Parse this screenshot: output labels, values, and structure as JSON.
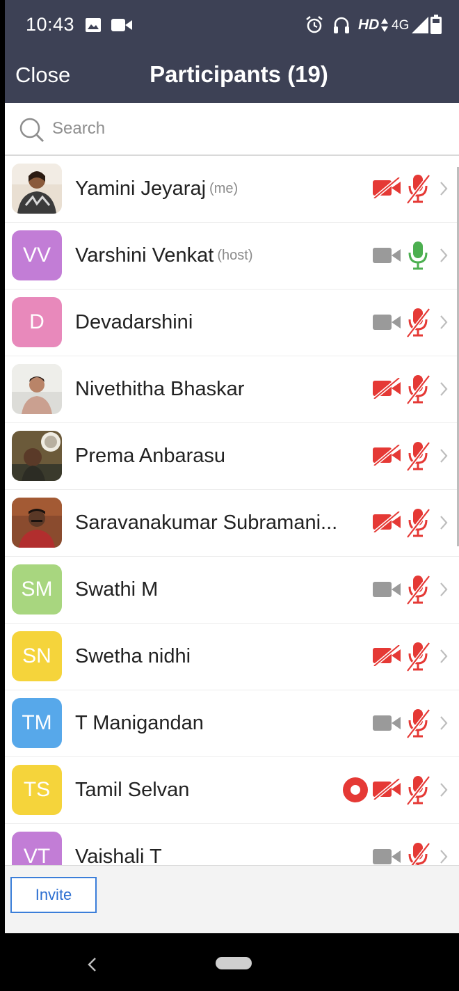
{
  "status_bar": {
    "time": "10:43",
    "network_label": "HD",
    "signal_label": "4G"
  },
  "header": {
    "close_label": "Close",
    "title": "Participants (19)"
  },
  "search": {
    "placeholder": "Search",
    "value": ""
  },
  "participants": [
    {
      "name": "Yamini Jeyaraj",
      "tag": "(me)",
      "avatar": "photo",
      "video": "off",
      "mic": "muted",
      "recording": false
    },
    {
      "name": "Varshini Venkat",
      "tag": "(host)",
      "avatar": "initials",
      "initials": "VV",
      "color": "#c27dd6",
      "video": "on",
      "mic": "active",
      "recording": false
    },
    {
      "name": "Devadarshini",
      "tag": "",
      "avatar": "initials",
      "initials": "D",
      "color": "#e889bb",
      "video": "on",
      "mic": "muted",
      "recording": false
    },
    {
      "name": "Nivethitha Bhaskar",
      "tag": "",
      "avatar": "photo",
      "video": "off",
      "mic": "muted",
      "recording": false
    },
    {
      "name": "Prema Anbarasu",
      "tag": "",
      "avatar": "photo",
      "video": "off",
      "mic": "muted",
      "recording": false
    },
    {
      "name": "Saravanakumar Subramani...",
      "tag": "",
      "avatar": "photo",
      "video": "off",
      "mic": "muted",
      "recording": false
    },
    {
      "name": "Swathi M",
      "tag": "",
      "avatar": "initials",
      "initials": "SM",
      "color": "#a8d67f",
      "video": "on",
      "mic": "muted",
      "recording": false
    },
    {
      "name": "Swetha nidhi",
      "tag": "",
      "avatar": "initials",
      "initials": "SN",
      "color": "#f5d43b",
      "video": "off",
      "mic": "muted",
      "recording": false
    },
    {
      "name": "T Manigandan",
      "tag": "",
      "avatar": "initials",
      "initials": "TM",
      "color": "#57a8ea",
      "video": "on",
      "mic": "muted",
      "recording": false
    },
    {
      "name": "Tamil Selvan",
      "tag": "",
      "avatar": "initials",
      "initials": "TS",
      "color": "#f5d43b",
      "video": "off",
      "mic": "muted",
      "recording": true
    },
    {
      "name": "Vaishali T",
      "tag": "",
      "avatar": "initials",
      "initials": "VT",
      "color": "#c27dd6",
      "video": "on",
      "mic": "muted",
      "recording": false
    }
  ],
  "footer": {
    "invite_label": "Invite"
  },
  "colors": {
    "header_bg": "#3d4155",
    "muted_red": "#e53935",
    "active_green": "#4caf50",
    "video_gray": "#9a9a9a",
    "invite_blue": "#2d6fd1"
  }
}
